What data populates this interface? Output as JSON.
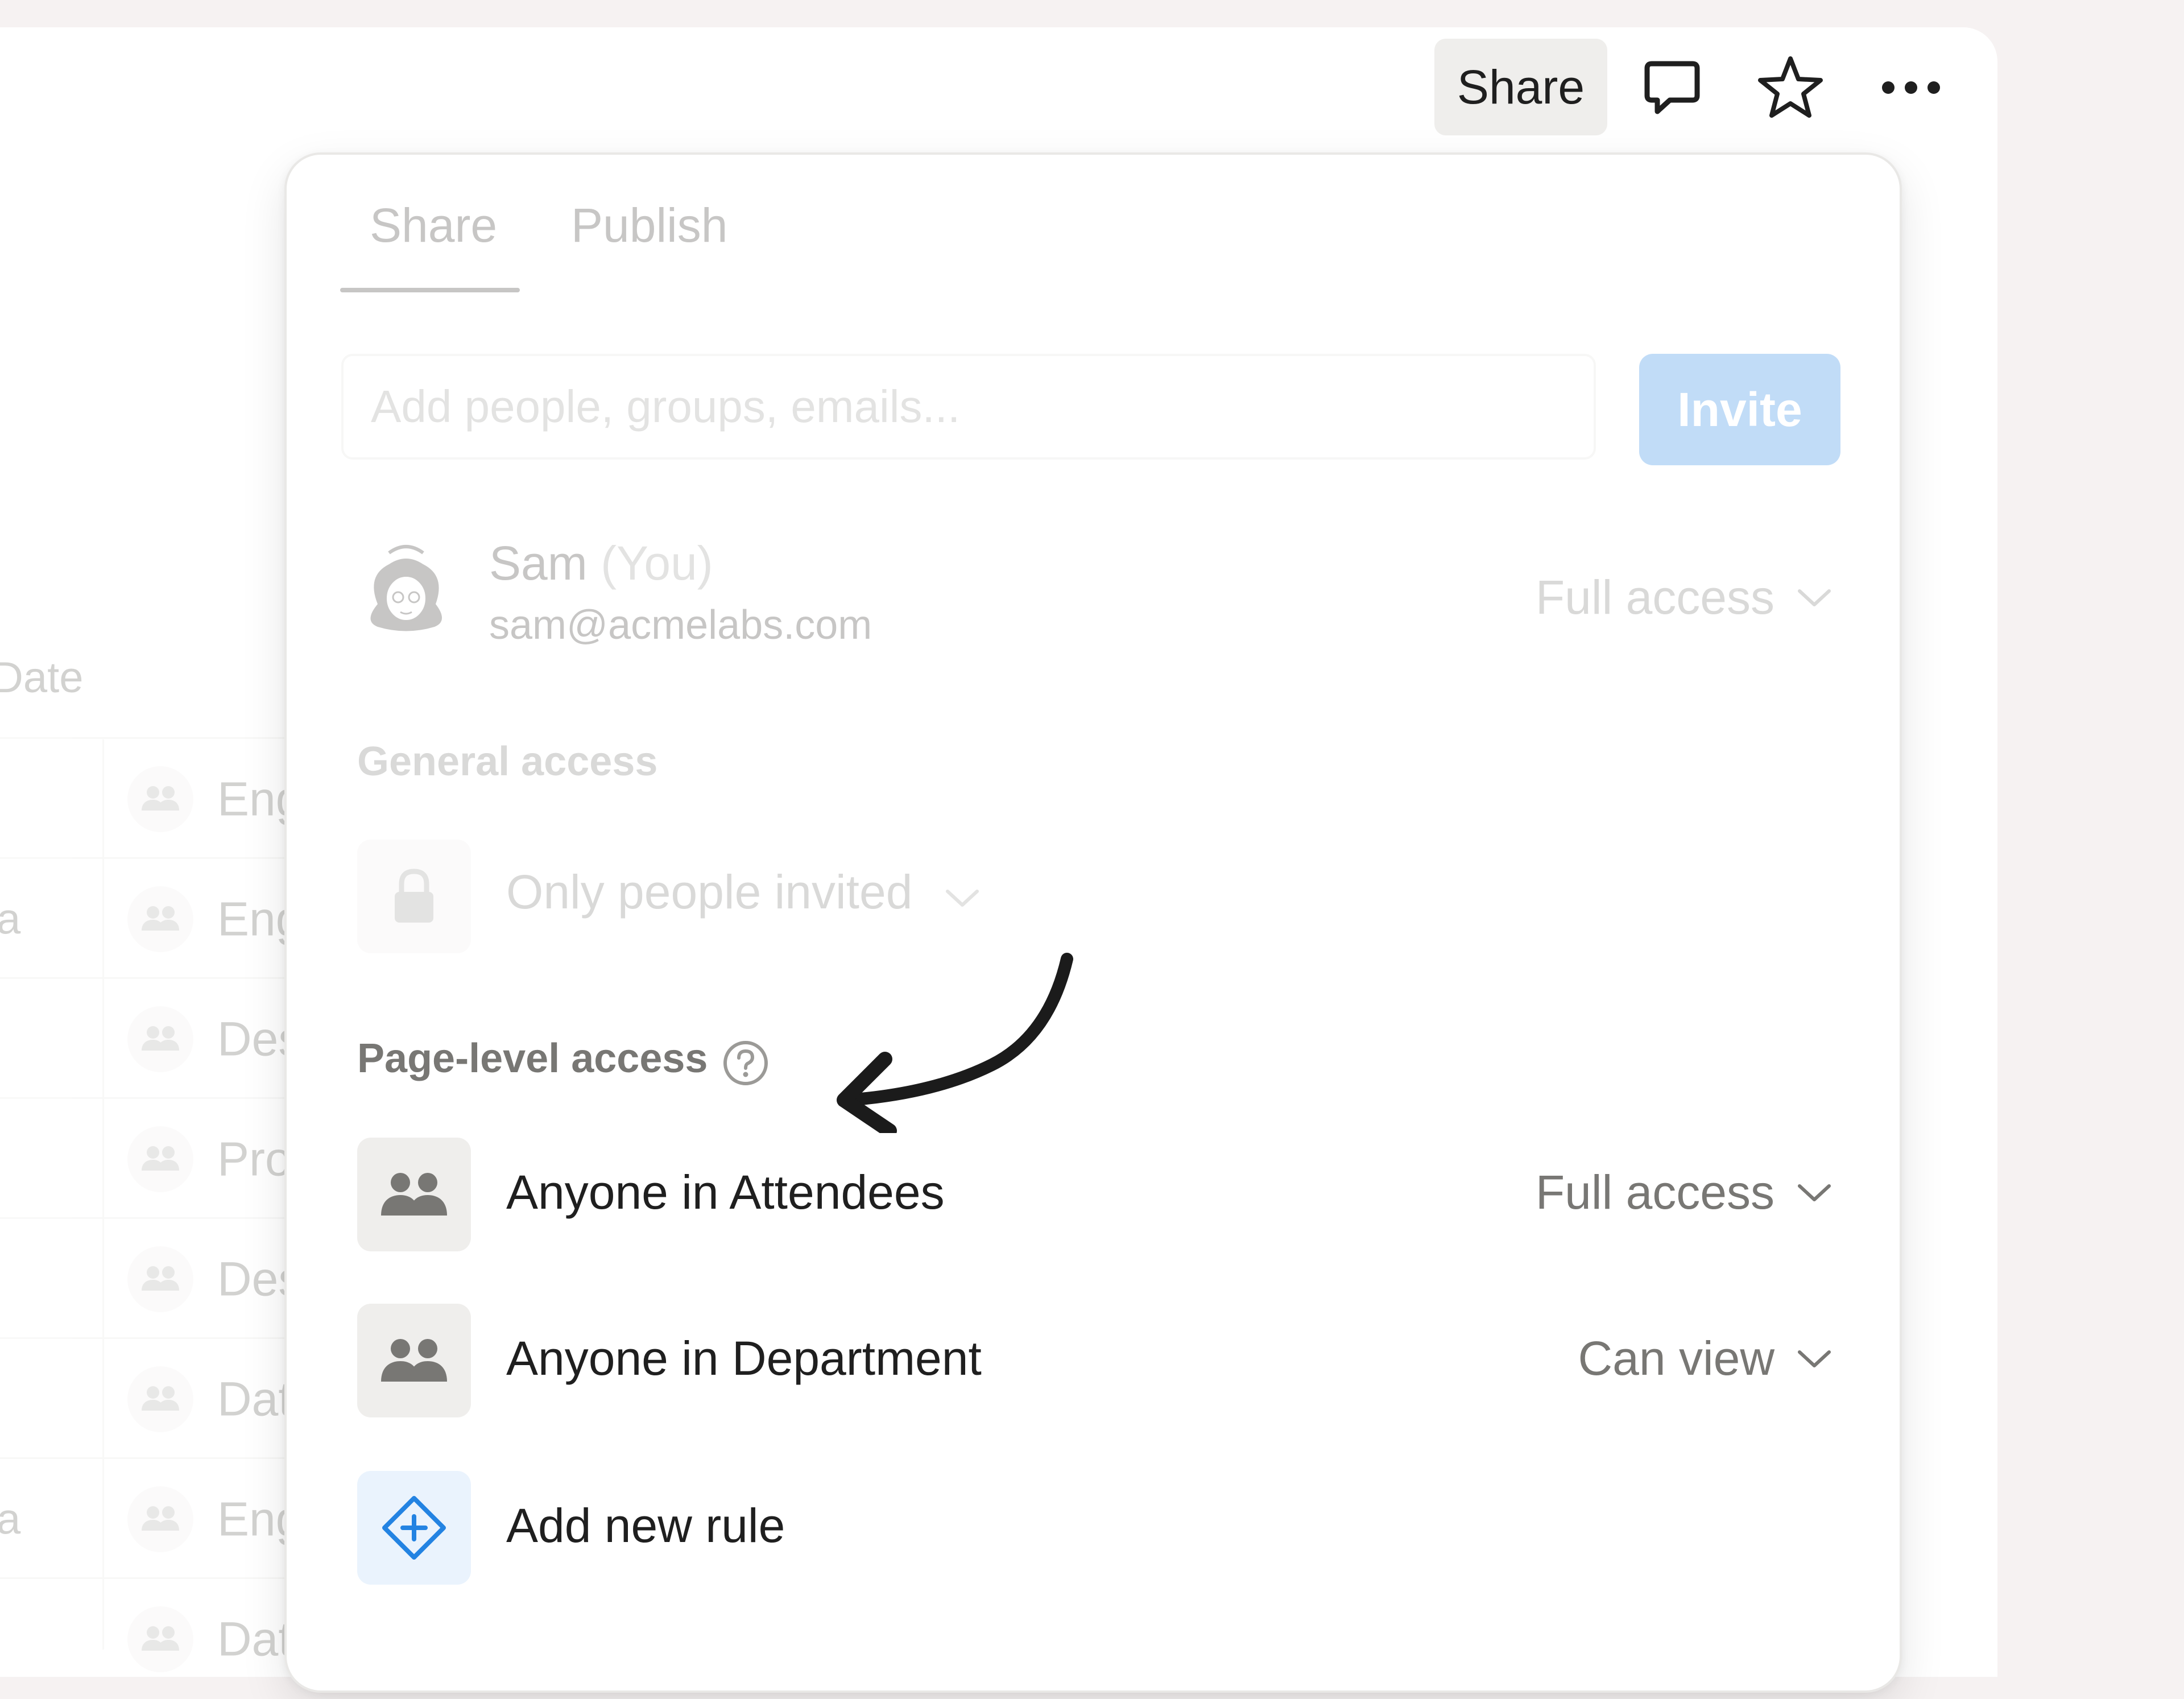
{
  "background_table": {
    "column_header": "Date",
    "rows": [
      {
        "left": "",
        "tag": "Eng"
      },
      {
        "left": "a",
        "tag": "Eng"
      },
      {
        "left": "",
        "tag": "Des"
      },
      {
        "left": "",
        "tag": "Pro"
      },
      {
        "left": "",
        "tag": "Des"
      },
      {
        "left": "",
        "tag": "Dat"
      },
      {
        "left": "a",
        "tag": "Eng"
      },
      {
        "left": "",
        "tag": "Dat"
      }
    ]
  },
  "topbar": {
    "share_label": "Share",
    "icons": [
      "comment-icon",
      "star-icon",
      "more-icon"
    ]
  },
  "share_popover": {
    "tabs": [
      {
        "label": "Share",
        "active": true
      },
      {
        "label": "Publish",
        "active": false
      }
    ],
    "invite": {
      "placeholder": "Add people, groups, emails...",
      "button_label": "Invite"
    },
    "owner": {
      "name": "Sam",
      "you_suffix": "(You)",
      "email": "sam@acmelabs.com",
      "permission": "Full access"
    },
    "general_access": {
      "heading": "General access",
      "value": "Only people invited"
    },
    "page_level_access": {
      "heading": "Page-level access",
      "rules": [
        {
          "label": "Anyone in Attendees",
          "permission": "Full access"
        },
        {
          "label": "Anyone in Department",
          "permission": "Can view"
        }
      ],
      "add_rule_label": "Add new rule"
    }
  },
  "colors": {
    "accent": "#2383e2",
    "text": "#1f1f1f",
    "muted": "#787774",
    "tile": "#efeeec"
  }
}
